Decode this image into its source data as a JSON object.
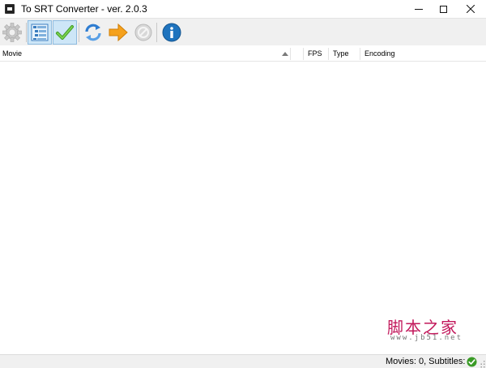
{
  "window": {
    "title": "To SRT Converter - ver. 2.0.3"
  },
  "toolbar": {
    "buttons": [
      {
        "name": "settings",
        "icon": "gear-icon",
        "pressed": false
      },
      {
        "name": "list-view",
        "icon": "list-view-icon",
        "pressed": true
      },
      {
        "name": "check",
        "icon": "checkmark-icon",
        "pressed": true
      },
      {
        "name": "refresh",
        "icon": "refresh-icon",
        "pressed": false
      },
      {
        "name": "convert",
        "icon": "arrow-right-icon",
        "pressed": false
      },
      {
        "name": "stop",
        "icon": "cancel-icon",
        "pressed": false
      },
      {
        "name": "about",
        "icon": "info-icon",
        "pressed": false
      }
    ]
  },
  "list": {
    "columns": [
      "Movie",
      "FPS",
      "Type",
      "Encoding"
    ],
    "sort_column": "Movie",
    "sort_direction": "ascending",
    "rows": []
  },
  "watermark": {
    "cn": "脚本之家",
    "url": "www.jb51.net"
  },
  "statusbar": {
    "text": "Movies: 0, Subtitles: 0",
    "status_icon": "ok-check-icon"
  },
  "colors": {
    "accent_green": "#4caf2e",
    "accent_blue": "#1e73be",
    "accent_orange": "#f5a11c",
    "watermark_red": "#c2185b"
  }
}
